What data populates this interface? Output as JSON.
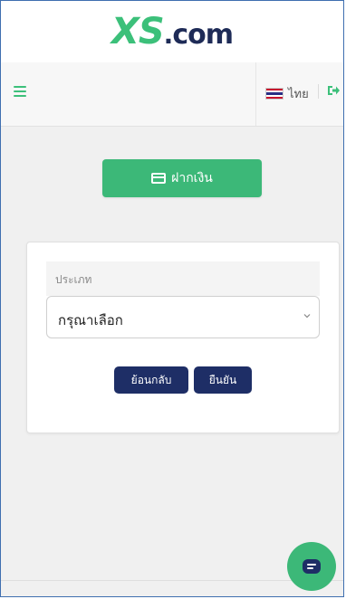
{
  "header": {
    "logo": {
      "xs": "XS",
      "dot": ".",
      "com": "com"
    }
  },
  "nav": {
    "language_label": "ไทย",
    "menu_icon": "hamburger-icon",
    "logout_icon": "logout-icon",
    "flag": "thailand-flag"
  },
  "deposit": {
    "label": "ฝากเงิน",
    "icon": "credit-card-icon"
  },
  "form": {
    "type_label": "ประเภท",
    "select_value": "กรุณาเลือก",
    "back_label": "ย้อนกลับ",
    "confirm_label": "ยืนยัน"
  },
  "colors": {
    "brand_green": "#3cb878",
    "brand_navy": "#1e2e66"
  },
  "chat": {
    "icon": "chat-icon"
  }
}
